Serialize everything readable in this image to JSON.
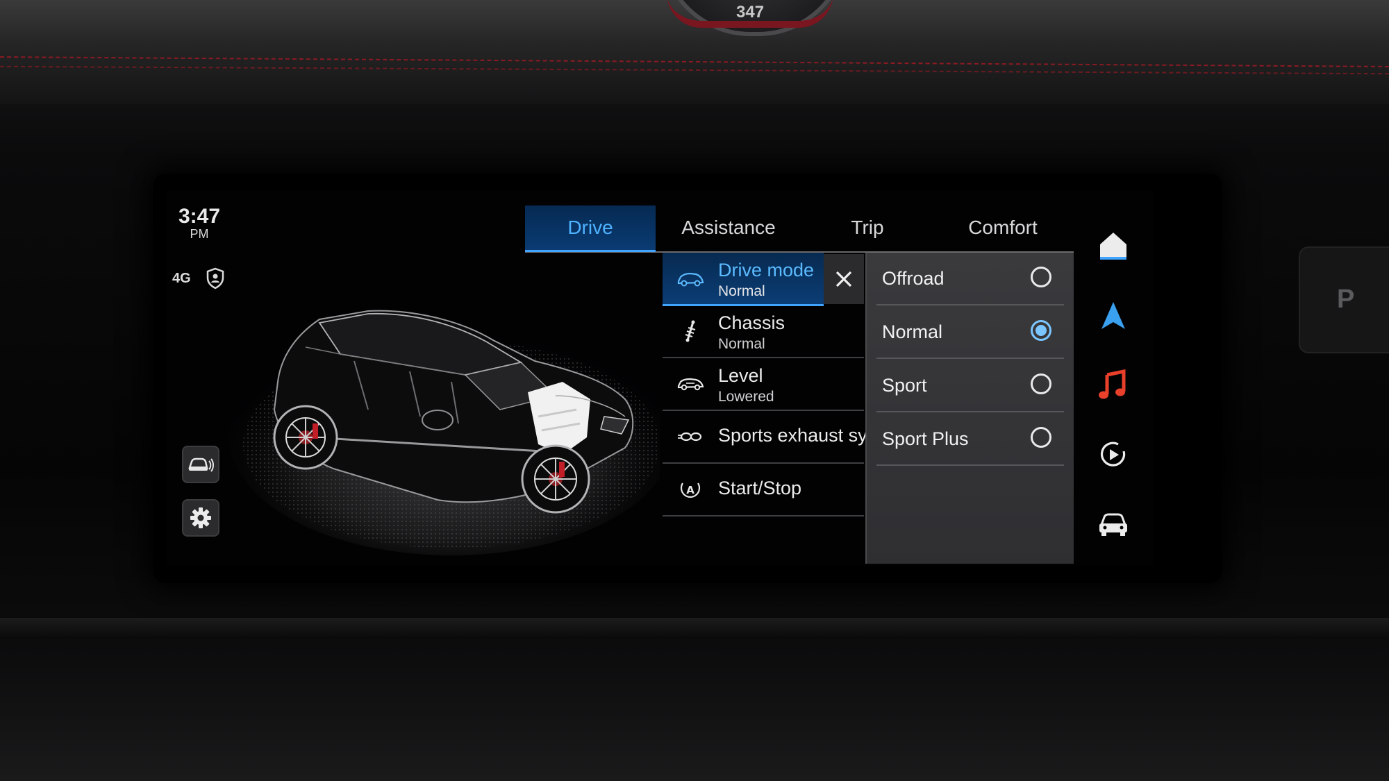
{
  "status": {
    "time": "3:47",
    "ampm": "PM",
    "network": "4G"
  },
  "tabs": [
    {
      "label": "Drive",
      "active": true
    },
    {
      "label": "Assistance",
      "active": false
    },
    {
      "label": "Trip",
      "active": false
    },
    {
      "label": "Comfort",
      "active": false
    }
  ],
  "menu": [
    {
      "label": "Drive mode",
      "value": "Normal",
      "icon": "car-side-icon",
      "selected": true
    },
    {
      "label": "Chassis",
      "value": "Normal",
      "icon": "shock-absorber-icon"
    },
    {
      "label": "Level",
      "value": "Lowered",
      "icon": "car-level-icon"
    },
    {
      "label": "Sports exhaust sy",
      "icon": "exhaust-icon"
    },
    {
      "label": "Start/Stop",
      "icon": "auto-start-stop-icon"
    }
  ],
  "options": [
    {
      "label": "Offroad",
      "selected": false
    },
    {
      "label": "Normal",
      "selected": true
    },
    {
      "label": "Sport",
      "selected": false
    },
    {
      "label": "Sport Plus",
      "selected": false
    }
  ],
  "rail": [
    "home-icon",
    "navigation-icon",
    "music-icon",
    "media-play-icon",
    "car-icon"
  ],
  "gear_indicator": "P",
  "gauge_readout": "347",
  "colors": {
    "accent": "#41a5ff",
    "navigation": "#3aa0f0",
    "music": "#e8402a"
  }
}
